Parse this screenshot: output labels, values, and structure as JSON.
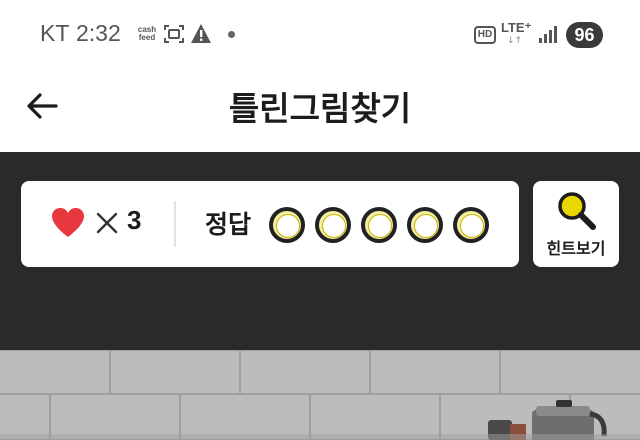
{
  "status_bar": {
    "carrier": "KT",
    "time": "2:32",
    "app_badge_line1": "cash",
    "app_badge_line2": "feed",
    "hd_label": "HD",
    "network_label": "LTE⁺",
    "network_arrows": "↓↑",
    "battery_level": "96",
    "icons": [
      "cashfeed-icon",
      "screenshot-icon",
      "warning-icon",
      "notification-dot-icon",
      "hd-icon",
      "signal-icon",
      "battery-icon"
    ]
  },
  "header": {
    "title": "틀린그림찾기",
    "back_icon": "arrow-left-icon"
  },
  "game_status": {
    "lives_icon": "heart-icon",
    "lives_prefix_icon": "times-icon",
    "lives_count": "3",
    "answer_label": "정답",
    "answers_found": 0,
    "answers_total": 5,
    "slot_color": "#f3eda0"
  },
  "hint": {
    "label": "힌트보기",
    "icon": "magnifier-icon",
    "icon_color": "#e8d800"
  },
  "colors": {
    "panel_bg": "#2a2a2a",
    "heart": "#e8373e",
    "card_bg": "#ffffff"
  }
}
